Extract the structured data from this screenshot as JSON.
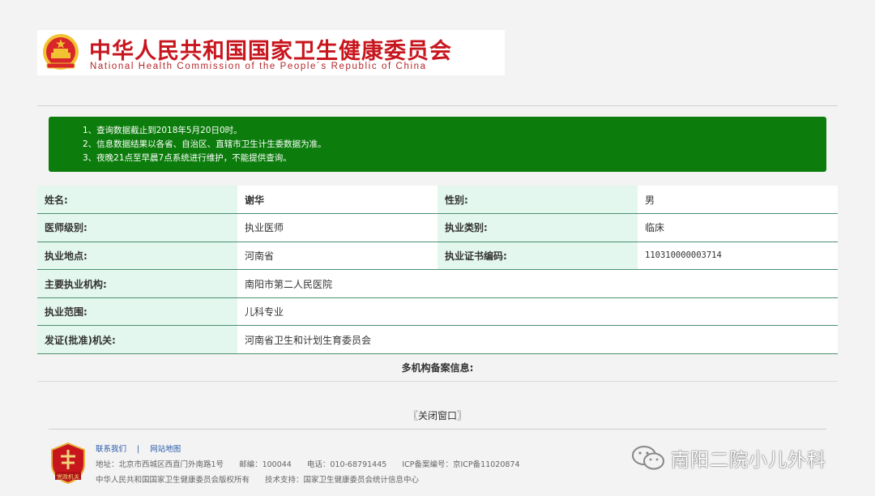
{
  "banner": {
    "title": "中华人民共和国国家卫生健康委员会",
    "subtitle": "National Health Commission of the People´s Republic of China"
  },
  "notice": [
    "1、查询数据截止到2018年5月20日0时。",
    "2、信息数据结果以各省、自治区、直辖市卫生计生委数据为准。",
    "3、夜晚21点至早晨7点系统进行维护，不能提供查询。"
  ],
  "info": {
    "name_label": "姓名:",
    "name_value": "谢华",
    "gender_label": "性别:",
    "gender_value": "男",
    "level_label": "医师级别:",
    "level_value": "执业医师",
    "category_label": "执业类别:",
    "category_value": "临床",
    "location_label": "执业地点:",
    "location_value": "河南省",
    "cert_label": "执业证书编码:",
    "cert_value": "110310000003714",
    "org_label": "主要执业机构:",
    "org_value": "南阳市第二人民医院",
    "scope_label": "执业范围:",
    "scope_value": "儿科专业",
    "issuer_label": "发证(批准)机关:",
    "issuer_value": "河南省卫生和计划生育委员会"
  },
  "multi_org_label": "多机构备案信息:",
  "close_label": "〖关闭窗口〗",
  "footer": {
    "contact_link": "联系我们",
    "separator": "|",
    "sitemap_link": "网站地图",
    "address": "地址：北京市西城区西直门外南路1号",
    "postcode": "邮编：100044",
    "phone": "电话：010-68791445",
    "icp": "ICP备案编号：京ICP备11020874",
    "copyright": "中华人民共和国国家卫生健康委员会版权所有",
    "support": "技术支持：国家卫生健康委员会统计信息中心",
    "badge_text": "党政机关"
  },
  "watermark": "南阳二院小儿外科",
  "colors": {
    "brand_red": "#c8161e",
    "notice_green": "#0c7d0c",
    "label_bg": "#e4f7ee",
    "row_border": "#4a8f6f",
    "link_blue": "#2a5caa"
  }
}
